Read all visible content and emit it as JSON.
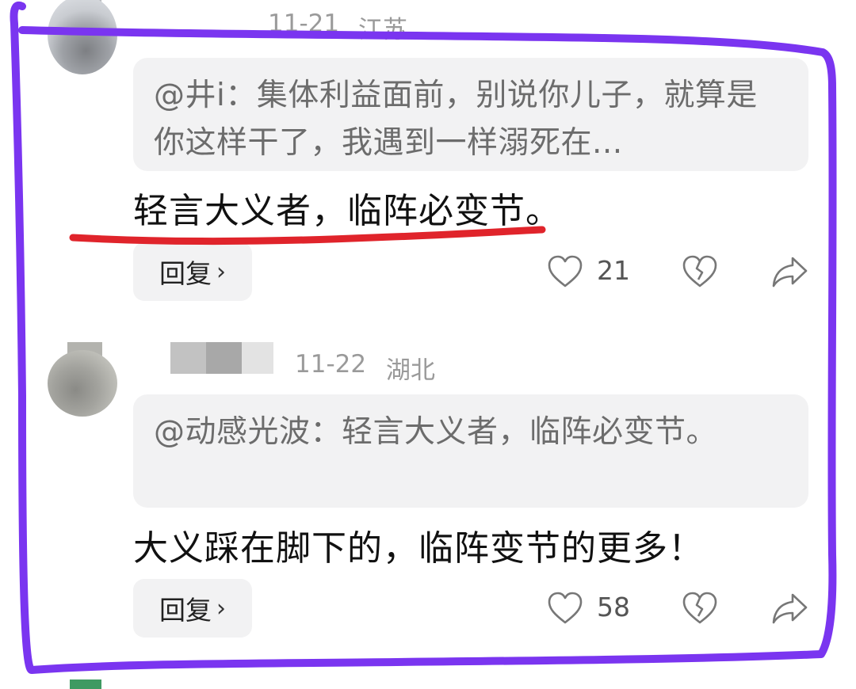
{
  "comments": [
    {
      "date": "11-21",
      "region": "江苏",
      "quote": "@井i：集体利益面前，别说你儿子，就算是你这样干了，我遇到一样溺死在...",
      "text": "轻言大义者，临阵必变节。",
      "reply_label": "回复",
      "likes": "21"
    },
    {
      "date": "11-22",
      "region": "湖北",
      "quote": "@动感光波：轻言大义者，临阵必变节。",
      "text": "大义踩在脚下的，临阵变节的更多！",
      "reply_label": "回复",
      "likes": "58"
    }
  ],
  "icons": {
    "like": "heart-icon",
    "dislike": "broken-heart-icon",
    "share": "share-icon",
    "reply_chevron": "chevron-right-icon"
  },
  "colors": {
    "frame_purple": "#7a35f0",
    "underline_red": "#e0242b",
    "meta_gray": "#9a9a9a",
    "quote_bg": "#f2f2f3"
  }
}
